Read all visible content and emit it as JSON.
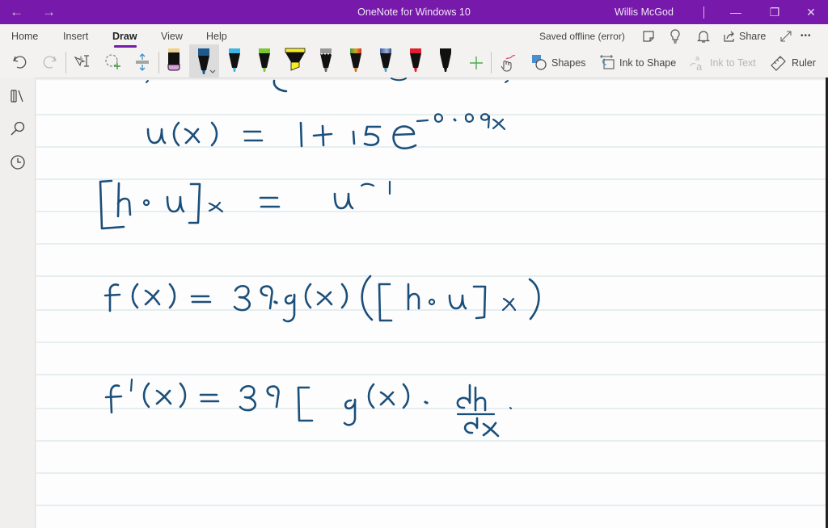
{
  "window": {
    "title": "OneNote for Windows 10",
    "user": "Willis McGod",
    "back_icon": "←",
    "forward_icon": "→",
    "minimize_icon": "—",
    "restore_icon": "❐",
    "close_icon": "✕"
  },
  "ribbon": {
    "tabs": [
      {
        "label": "Home"
      },
      {
        "label": "Insert"
      },
      {
        "label": "Draw",
        "active": true
      },
      {
        "label": "View"
      },
      {
        "label": "Help"
      }
    ],
    "status": "Saved offline (error)",
    "share_label": "Share",
    "more_icon": "•••"
  },
  "draw_tools": {
    "pens": [
      {
        "name": "eraser",
        "color": "#d8a0e0",
        "cap": "#f1d08a"
      },
      {
        "name": "pen-dark-blue",
        "color": "#1a5a8e",
        "selected": true
      },
      {
        "name": "pen-light-blue",
        "color": "#3cb4e6"
      },
      {
        "name": "pen-green",
        "color": "#78c832"
      },
      {
        "name": "highlighter-yellow",
        "color": "#f5ee22"
      },
      {
        "name": "pen-galaxy",
        "color": "#999999"
      },
      {
        "name": "pen-rainbow",
        "color": "#c8781e"
      },
      {
        "name": "pen-ocean",
        "color": "#5a7ab4"
      },
      {
        "name": "pen-red",
        "color": "#e02030"
      },
      {
        "name": "pen-black",
        "color": "#111111"
      }
    ],
    "add_pen_icon": "+",
    "shapes_label": "Shapes",
    "ink_to_shape_label": "Ink to Shape",
    "ink_to_text_label": "Ink to Text",
    "ruler_label": "Ruler"
  },
  "note": {
    "ink_color": "#1b4f7a",
    "lines": [
      "u(x) = 1 + 15e^(-0.09x)",
      "[h ∘ u]x = u^-1",
      "f(x) = 39·g(x)([h ∘ u]x)",
      "f'(x) = 39 [ g(x) · dh/dx ·"
    ]
  }
}
